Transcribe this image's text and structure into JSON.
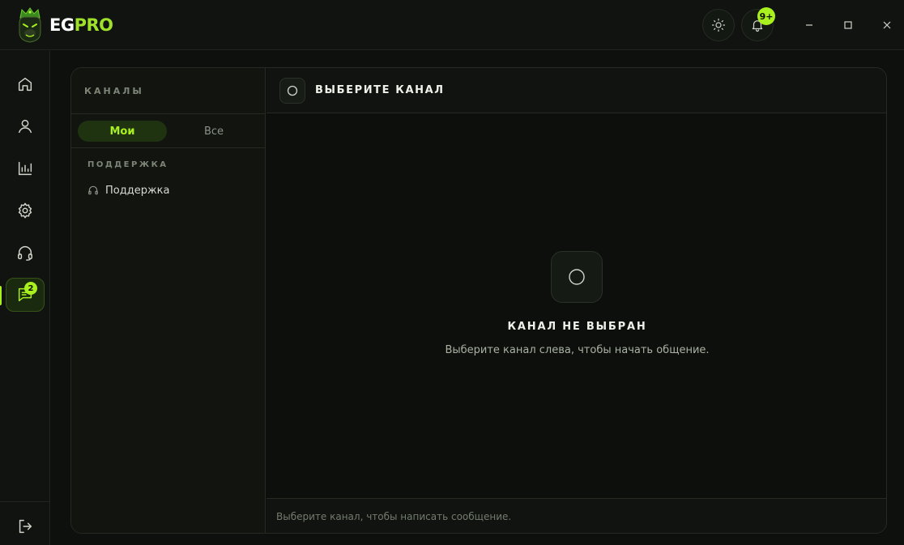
{
  "app": {
    "brand_prefix": "EG",
    "brand_suffix": "PRO",
    "notifications_badge": "9+"
  },
  "colors": {
    "accent": "#a8f01e",
    "background": "#0d100c",
    "surface": "#11140f",
    "border": "#252b23"
  },
  "titlebar": {
    "icons": [
      "theme-sun-icon",
      "bell-icon",
      "minimize-icon",
      "maximize-icon",
      "close-icon"
    ]
  },
  "rail": {
    "items": [
      {
        "icon": "home-icon",
        "active": false
      },
      {
        "icon": "user-icon",
        "active": false
      },
      {
        "icon": "stats-icon",
        "active": false
      },
      {
        "icon": "settings-icon",
        "active": false
      },
      {
        "icon": "headset-icon",
        "active": false
      },
      {
        "icon": "chat-icon",
        "active": true,
        "badge": "2"
      }
    ],
    "bottom_icon": "logout-icon"
  },
  "channels": {
    "title": "КАНАЛЫ",
    "tabs": [
      {
        "label": "Мои",
        "active": true
      },
      {
        "label": "Все",
        "active": false
      }
    ],
    "groups": [
      {
        "label": "ПОДДЕРЖКА",
        "items": [
          {
            "label": "Поддержка",
            "icon": "headset-icon"
          }
        ]
      }
    ]
  },
  "chat": {
    "header_title": "ВЫБЕРИТЕ КАНАЛ",
    "empty_title": "КАНАЛ НЕ ВЫБРАН",
    "empty_subtitle": "Выберите канал слева, чтобы начать общение.",
    "composer_hint": "Выберите канал, чтобы написать сообщение."
  }
}
